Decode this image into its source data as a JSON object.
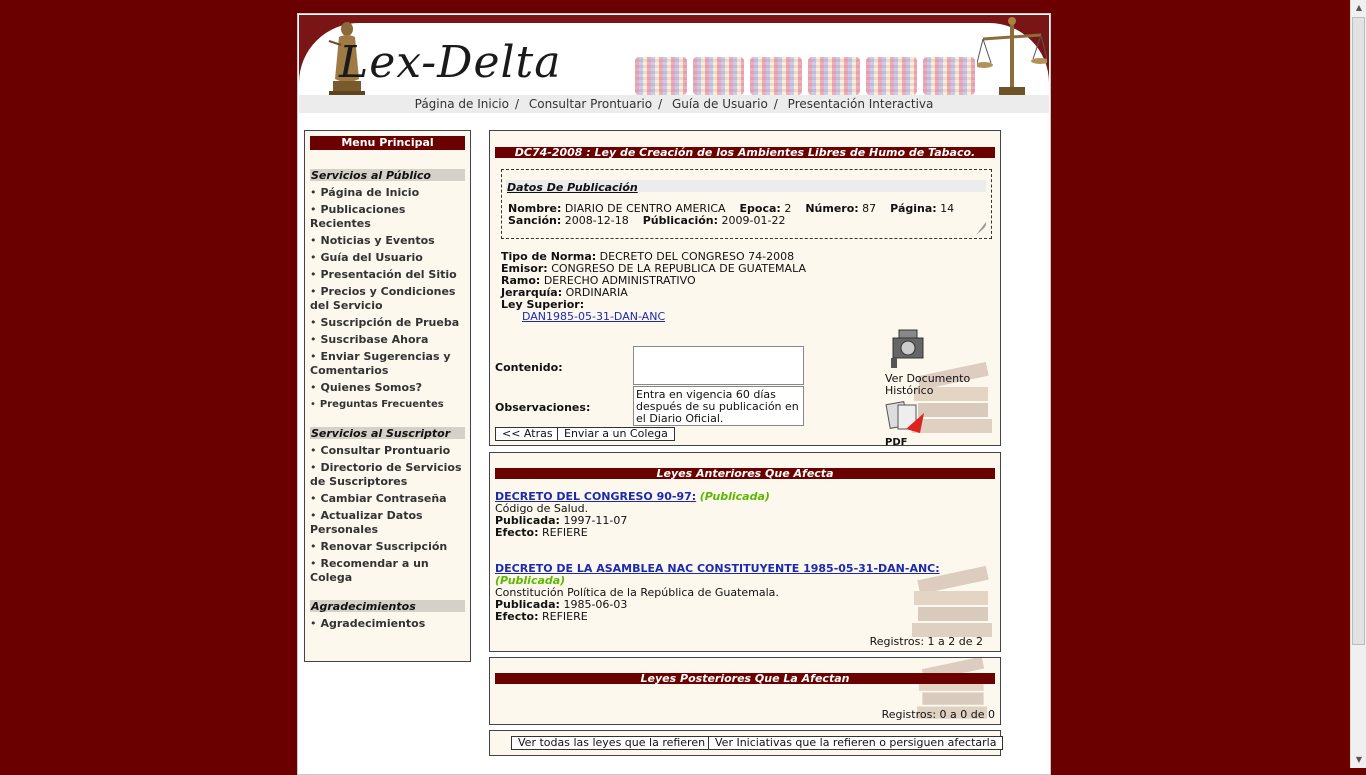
{
  "header": {
    "logo_text": "Lex-Delta",
    "nav": [
      "Página de Inicio",
      "Consultar Prontuario",
      "Guía de Usuario",
      "Presentación Interactiva"
    ]
  },
  "sidebar": {
    "title": "Menu Principal",
    "sections": [
      {
        "title": "Servicios al Público",
        "items": [
          "Página de Inicio",
          "Publicaciones Recientes",
          "Noticias y Eventos",
          "Guía del Usuario",
          "Presentación del Sitio",
          "Precios y Condiciones del Servicio",
          "Suscripción de Prueba",
          "Suscribase Ahora",
          "Enviar Sugerencias y Comentarios",
          "Quienes Somos?",
          "Preguntas Frecuentes"
        ]
      },
      {
        "title": "Servicios al Suscriptor",
        "items": [
          "Consultar Prontuario",
          "Directorio de Servicios de Suscriptores",
          "Cambiar Contraseña",
          "Actualizar Datos Personales",
          "Renovar Suscripción",
          "Recomendar a un Colega"
        ]
      },
      {
        "title": "Agradecimientos",
        "items": [
          "Agradecimientos"
        ]
      }
    ]
  },
  "document": {
    "title": "DC74-2008 : Ley de Creación de los Ambientes Libres de Humo de Tabaco.",
    "publication": {
      "heading": "Datos De Publicación",
      "nombre_label": "Nombre:",
      "nombre": "DIARIO DE CENTRO AMERICA",
      "epoca_label": "Epoca:",
      "epoca": "2",
      "numero_label": "Número:",
      "numero": "87",
      "pagina_label": "Página:",
      "pagina": "14",
      "sancion_label": "Sanción:",
      "sancion": "2008-12-18",
      "publicacion_label": "Públicación:",
      "publicacion": "2009-01-22"
    },
    "tipo_label": "Tipo de Norma:",
    "tipo": "DECRETO DEL CONGRESO 74-2008",
    "emisor_label": "Emisor:",
    "emisor": "CONGRESO DE LA REPUBLICA DE GUATEMALA",
    "ramo_label": "Ramo:",
    "ramo": "DERECHO ADMINISTRATIVO",
    "jerarquia_label": "Jerarquía:",
    "jerarquia": "ORDINARIA",
    "ley_superior_label": "Ley Superior:",
    "ley_superior_link": "DAN1985-05-31-DAN-ANC",
    "contenido_label": "Contenido:",
    "contenido_value": "",
    "observaciones_label": "Observaciones:",
    "observaciones_value": "Entra en vigencia 60 días después de su publicación en el Diario Oficial.",
    "ver_documento": "Ver Documento Histórico",
    "pdf_label": "PDF",
    "back_button": "<< Atras",
    "send_button": "Enviar a un Colega"
  },
  "leyes_anteriores": {
    "title": "Leyes Anteriores Que Afecta",
    "items": [
      {
        "link": "DECRETO DEL CONGRESO 90-97:",
        "status": "(Publicada)",
        "desc": "Código de Salud.",
        "publicada_label": "Publicada:",
        "publicada": "1997-11-07",
        "efecto_label": "Efecto:",
        "efecto": "REFIERE"
      },
      {
        "link": "DECRETO DE LA ASAMBLEA NAC CONSTITUYENTE 1985-05-31-DAN-ANC:",
        "status": "(Publicada)",
        "desc": "Constitución Política de la República de Guatemala.",
        "publicada_label": "Publicada:",
        "publicada": "1985-06-03",
        "efecto_label": "Efecto:",
        "efecto": "REFIERE"
      }
    ],
    "registros": "Registros: 1 a 2 de 2"
  },
  "leyes_posteriores": {
    "title": "Leyes Posteriores Que La Afectan",
    "registros": "Registros: 0 a 0 de 0"
  },
  "bottom_buttons": {
    "ver_todas": "Ver todas las leyes que la refieren",
    "ver_iniciativas": "Ver Iniciativas que la refieren o persiguen afectarla"
  },
  "colors": {
    "background": "#6b0000",
    "bar": "#6b0000",
    "panel": "#fdf8ee",
    "link": "#1c2ab0",
    "status": "#5cb800"
  }
}
